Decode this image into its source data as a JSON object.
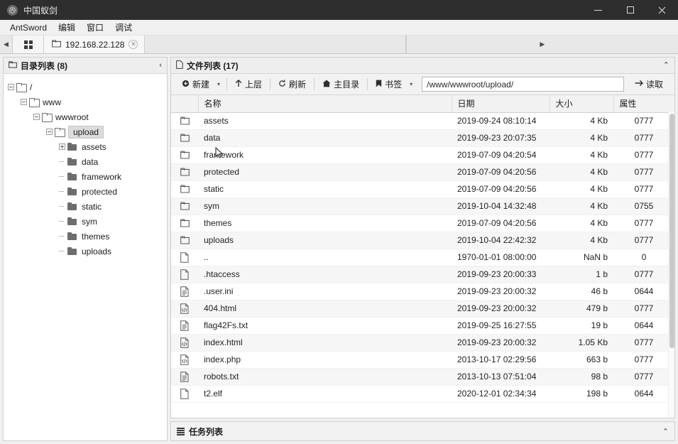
{
  "window": {
    "title": "中国蚁剑",
    "logo_icon": "antsword-logo-icon",
    "minimize_label": "−",
    "maximize_label": "□",
    "close_label": "✕"
  },
  "menubar": {
    "items": [
      {
        "label": "AntSword"
      },
      {
        "label": "编辑"
      },
      {
        "label": "窗口"
      },
      {
        "label": "调试"
      }
    ]
  },
  "tabbar": {
    "scroll_left": "◀",
    "scroll_right": "▶",
    "grid_button": "grid-view-button",
    "tabs": [
      {
        "label": "192.168.22.128",
        "close": "✕",
        "active": true
      }
    ]
  },
  "sidebar": {
    "title": "目录列表 (8)",
    "count": 8,
    "collapse_chevron": "‹",
    "tree": [
      {
        "label": "/",
        "depth": 0,
        "toggle": "minus",
        "icon": "folder-outline-icon",
        "selected": false
      },
      {
        "label": "www",
        "depth": 1,
        "toggle": "minus",
        "icon": "folder-outline-icon",
        "selected": false
      },
      {
        "label": "wwwroot",
        "depth": 2,
        "toggle": "minus",
        "icon": "folder-outline-icon",
        "selected": false
      },
      {
        "label": "upload",
        "depth": 3,
        "toggle": "minus",
        "icon": "folder-outline-icon",
        "selected": true
      },
      {
        "label": "assets",
        "depth": 4,
        "toggle": "plus",
        "icon": "folder-solid-icon",
        "selected": false
      },
      {
        "label": "data",
        "depth": 4,
        "toggle": "none",
        "icon": "folder-solid-icon",
        "selected": false
      },
      {
        "label": "framework",
        "depth": 4,
        "toggle": "none",
        "icon": "folder-solid-icon",
        "selected": false
      },
      {
        "label": "protected",
        "depth": 4,
        "toggle": "none",
        "icon": "folder-solid-icon",
        "selected": false
      },
      {
        "label": "static",
        "depth": 4,
        "toggle": "none",
        "icon": "folder-solid-icon",
        "selected": false
      },
      {
        "label": "sym",
        "depth": 4,
        "toggle": "none",
        "icon": "folder-solid-icon",
        "selected": false
      },
      {
        "label": "themes",
        "depth": 4,
        "toggle": "none",
        "icon": "folder-solid-icon",
        "selected": false
      },
      {
        "label": "uploads",
        "depth": 4,
        "toggle": "none",
        "icon": "folder-solid-icon",
        "selected": false
      }
    ]
  },
  "filepanel": {
    "title": "文件列表 (17)",
    "count": 17,
    "collapse_chevron": "⌃",
    "toolbar": {
      "new_label": "新建",
      "new_icon": "plus-circle-icon",
      "new_caret": "▾",
      "up_label": "上层",
      "up_icon": "arrow-up-icon",
      "refresh_label": "刷新",
      "refresh_icon": "refresh-icon",
      "home_label": "主目录",
      "home_icon": "home-icon",
      "bookmark_label": "书签",
      "bookmark_icon": "bookmark-icon",
      "bookmark_caret": "▾",
      "path_value": "/www/wwwroot/upload/",
      "path_placeholder": "/www/wwwroot/upload/",
      "read_label": "读取",
      "read_icon": "arrow-right-icon"
    },
    "columns": [
      "",
      "名称",
      "日期",
      "大小",
      "属性"
    ],
    "rows": [
      {
        "icon": "folder",
        "name": "assets",
        "date": "2019-09-24 08:10:14",
        "size": "4 Kb",
        "attr": "0777"
      },
      {
        "icon": "folder",
        "name": "data",
        "date": "2019-09-23 20:07:35",
        "size": "4 Kb",
        "attr": "0777"
      },
      {
        "icon": "folder",
        "name": "framework",
        "date": "2019-07-09 04:20:54",
        "size": "4 Kb",
        "attr": "0777"
      },
      {
        "icon": "folder",
        "name": "protected",
        "date": "2019-07-09 04:20:56",
        "size": "4 Kb",
        "attr": "0777"
      },
      {
        "icon": "folder",
        "name": "static",
        "date": "2019-07-09 04:20:56",
        "size": "4 Kb",
        "attr": "0777"
      },
      {
        "icon": "folder",
        "name": "sym",
        "date": "2019-10-04 14:32:48",
        "size": "4 Kb",
        "attr": "0755"
      },
      {
        "icon": "folder",
        "name": "themes",
        "date": "2019-07-09 04:20:56",
        "size": "4 Kb",
        "attr": "0777"
      },
      {
        "icon": "folder",
        "name": "uploads",
        "date": "2019-10-04 22:42:32",
        "size": "4 Kb",
        "attr": "0777"
      },
      {
        "icon": "file",
        "name": "..",
        "date": "1970-01-01 08:00:00",
        "size": "NaN b",
        "attr": "0"
      },
      {
        "icon": "file",
        "name": ".htaccess",
        "date": "2019-09-23 20:00:33",
        "size": "1 b",
        "attr": "0777"
      },
      {
        "icon": "text",
        "name": ".user.ini",
        "date": "2019-09-23 20:00:32",
        "size": "46 b",
        "attr": "0644"
      },
      {
        "icon": "code",
        "name": "404.html",
        "date": "2019-09-23 20:00:32",
        "size": "479 b",
        "attr": "0777"
      },
      {
        "icon": "text",
        "name": "flag42Fs.txt",
        "date": "2019-09-25 16:27:55",
        "size": "19 b",
        "attr": "0644"
      },
      {
        "icon": "code",
        "name": "index.html",
        "date": "2019-09-23 20:00:32",
        "size": "1.05 Kb",
        "attr": "0777"
      },
      {
        "icon": "code",
        "name": "index.php",
        "date": "2013-10-17 02:29:56",
        "size": "663 b",
        "attr": "0777"
      },
      {
        "icon": "text",
        "name": "robots.txt",
        "date": "2013-10-13 07:51:04",
        "size": "98 b",
        "attr": "0777"
      },
      {
        "icon": "file",
        "name": "t2.elf",
        "date": "2020-12-01 02:34:34",
        "size": "198 b",
        "attr": "0644"
      }
    ]
  },
  "taskpanel": {
    "title": "任务列表",
    "list_icon": "task-list-icon",
    "collapse_chevron": "⌃"
  },
  "colors": {
    "titlebar_bg": "#2e2e2e",
    "chrome_bg": "#f0f0f0",
    "panel_bg": "#ffffff",
    "row_alt_bg": "#f6f6f6",
    "border": "#cfcfcf",
    "text": "#1b1b1b"
  }
}
